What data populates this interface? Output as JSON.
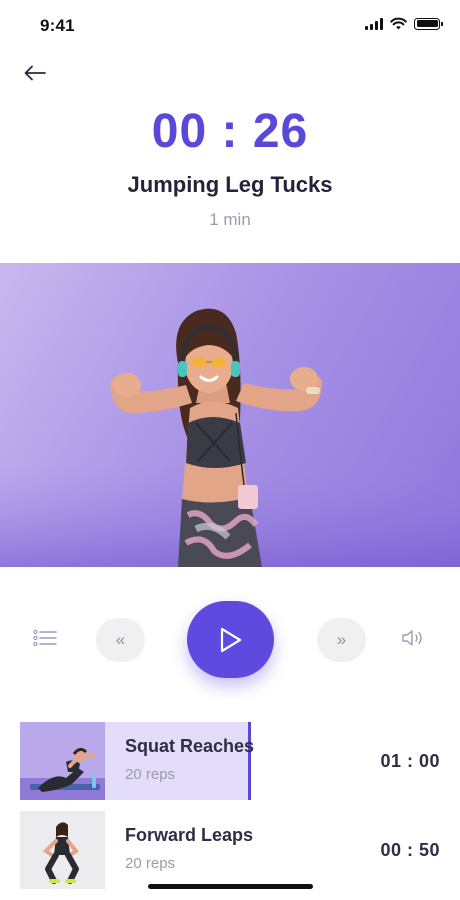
{
  "status_bar": {
    "time": "9:41"
  },
  "header": {
    "back_icon": "arrow-left-icon",
    "timer": "00 : 26",
    "exercise_title": "Jumping Leg Tucks",
    "exercise_duration": "1 min"
  },
  "controls": {
    "list_icon": "list-icon",
    "prev_label": "«",
    "play_icon": "play-icon",
    "next_label": "»",
    "volume_icon": "volume-icon"
  },
  "queue": [
    {
      "title": "Squat Reaches",
      "reps": "20 reps",
      "time": "01 : 00",
      "active": true,
      "progress": 0.55
    },
    {
      "title": "Forward Leaps",
      "reps": "20 reps",
      "time": "00 : 50",
      "active": false
    }
  ],
  "colors": {
    "accent": "#5a48d8",
    "play": "#5f4ae0",
    "active_row": "#e3dcfb"
  }
}
